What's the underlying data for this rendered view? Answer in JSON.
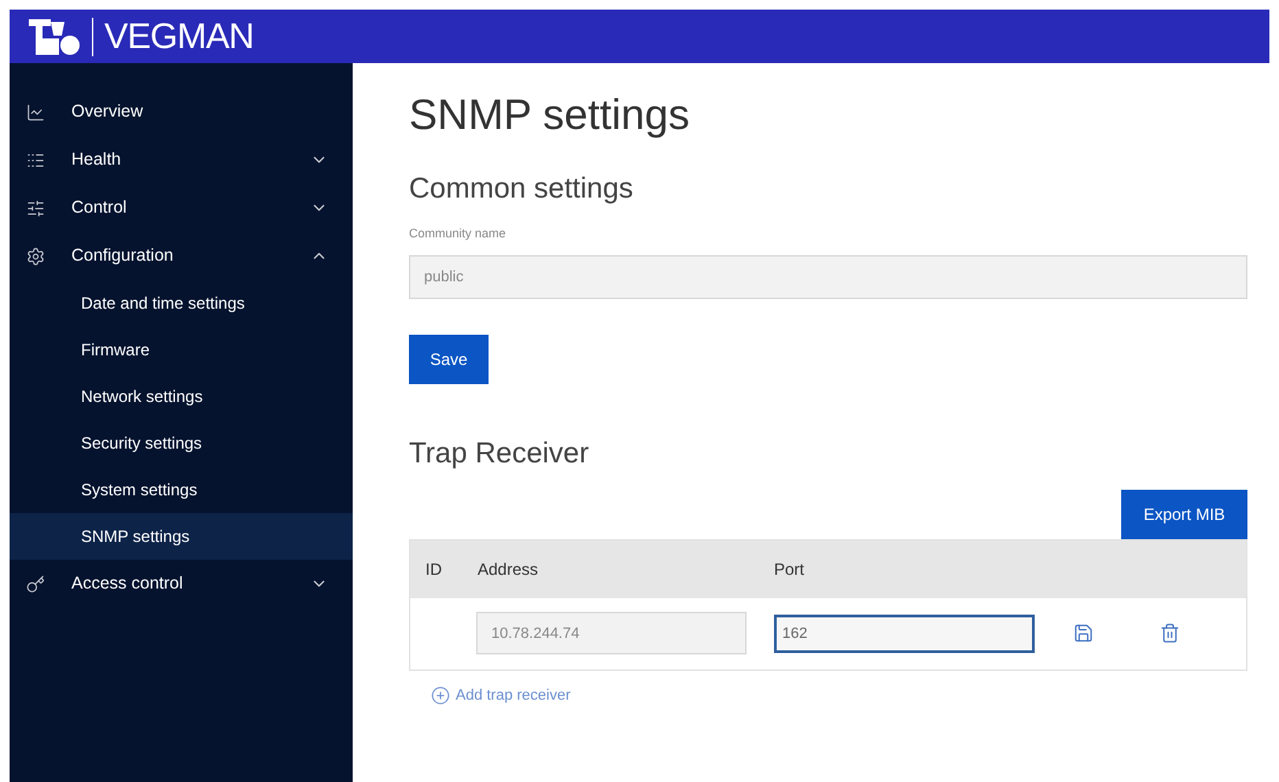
{
  "header": {
    "brand": "VEGMAN"
  },
  "sidebar": {
    "items": [
      {
        "label": "Overview",
        "selected": false
      },
      {
        "label": "Health",
        "expanded": false,
        "selected": false
      },
      {
        "label": "Control",
        "expanded": false,
        "selected": false
      },
      {
        "label": "Configuration",
        "expanded": true,
        "selected": false,
        "children": [
          {
            "label": "Date and time settings",
            "selected": false
          },
          {
            "label": "Firmware",
            "selected": false
          },
          {
            "label": "Network settings",
            "selected": false
          },
          {
            "label": "Security settings",
            "selected": false
          },
          {
            "label": "System settings",
            "selected": false
          },
          {
            "label": "SNMP settings",
            "selected": true
          }
        ]
      },
      {
        "label": "Access control",
        "expanded": false,
        "selected": false
      }
    ]
  },
  "page": {
    "title": "SNMP settings",
    "common": {
      "heading": "Common settings",
      "field_label": "Community name",
      "field_value": "public",
      "save_button": "Save"
    },
    "trap": {
      "heading": "Trap Receiver",
      "export_button": "Export MIB",
      "columns": [
        "ID",
        "Address",
        "Port"
      ],
      "rows": [
        {
          "address": "10.78.244.74",
          "port": "162"
        }
      ],
      "add_link": "Add trap receiver"
    }
  }
}
